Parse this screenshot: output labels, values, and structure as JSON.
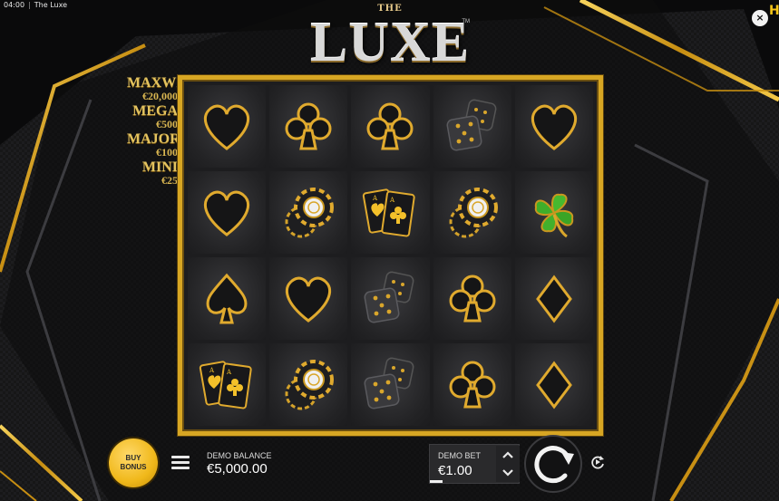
{
  "status_bar": {
    "time": "04:00",
    "separator": "|",
    "title": "The Luxe"
  },
  "close_button": {
    "label": "×"
  },
  "provider_logo": {
    "label": "H"
  },
  "logo": {
    "small": "THE",
    "main": "LUXE",
    "tm": "TM"
  },
  "jackpots": [
    {
      "name": "MAXWIN",
      "value": "€20,000"
    },
    {
      "name": "MEGA",
      "value": "€500"
    },
    {
      "name": "MAJOR",
      "value": "€100"
    },
    {
      "name": "MINI",
      "value": "€25"
    }
  ],
  "reels": [
    [
      "heart",
      "club",
      "club",
      "dice",
      "heart"
    ],
    [
      "heart",
      "chips",
      "cards",
      "chips",
      "clover"
    ],
    [
      "spade",
      "heart",
      "dice",
      "club",
      "diamond"
    ],
    [
      "cards",
      "chips",
      "dice",
      "club",
      "diamond"
    ]
  ],
  "colors": {
    "gold": "#d7a623",
    "clover_green": "#3fae2a",
    "bonus_yellow": "#f0b81a"
  },
  "buy_bonus": {
    "line1": "BUY",
    "line2": "BONUS"
  },
  "balance": {
    "label": "DEMO BALANCE",
    "value": "€5,000.00"
  },
  "bet": {
    "label": "DEMO BET",
    "value": "€1.00"
  },
  "icons": {
    "menu": "hamburger-icon",
    "spin": "spin-icon",
    "autoplay": "autoplay-icon",
    "bet_up": "chevron-up-icon",
    "bet_down": "chevron-down-icon"
  }
}
